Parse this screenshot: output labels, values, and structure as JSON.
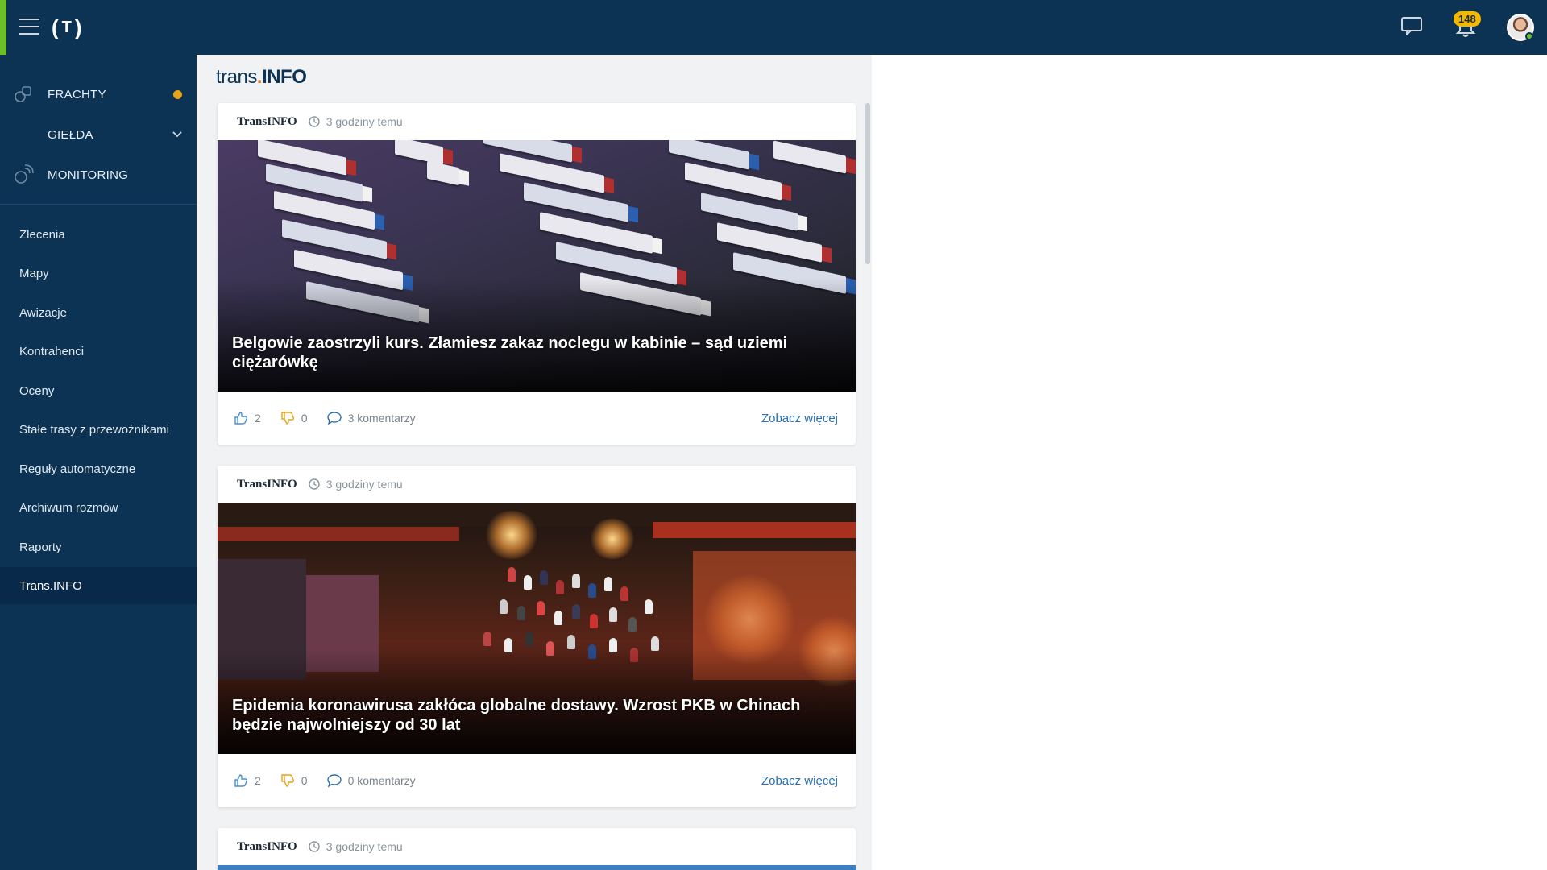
{
  "topbar": {
    "logo_letter": "T",
    "notification_count": "148",
    "icons": [
      "menu-icon",
      "chat-icon",
      "bell-icon",
      "avatar"
    ]
  },
  "sidebar": {
    "sections": [
      {
        "label": "FRACHTY",
        "icon": "boxes-icon",
        "status": "orange-dot"
      },
      {
        "label": "GIEŁDA",
        "icon": "",
        "chevron": "chevron-down-icon"
      },
      {
        "label": "MONITORING",
        "icon": "satellite-icon"
      }
    ],
    "items": [
      {
        "label": "Zlecenia"
      },
      {
        "label": "Mapy"
      },
      {
        "label": "Awizacje"
      },
      {
        "label": "Kontrahenci"
      },
      {
        "label": "Oceny"
      },
      {
        "label": "Stałe trasy z przewoźnikami"
      },
      {
        "label": "Reguły automatyczne"
      },
      {
        "label": "Archiwum rozmów"
      },
      {
        "label": "Raporty"
      },
      {
        "label": "Trans.INFO",
        "active": true
      }
    ]
  },
  "main": {
    "brand": {
      "prefix": "trans",
      "dot": ".",
      "suffix": "INFO"
    },
    "articles": [
      {
        "source": "TransINFO",
        "time": "3 godziny temu",
        "title": "Belgowie zaostrzyli kurs. Złamiesz zakaz noclegu w kabinie – sąd uziemi ciężarówkę",
        "likes": "2",
        "dislikes": "0",
        "comments": "3 komentarzy",
        "more": "Zobacz więcej"
      },
      {
        "source": "TransINFO",
        "time": "3 godziny temu",
        "title": "Epidemia koronawirusa zakłóca globalne dostawy. Wzrost PKB w Chinach będzie najwolniejszy od 30 lat",
        "likes": "2",
        "dislikes": "0",
        "comments": "0 komentarzy",
        "more": "Zobacz więcej"
      },
      {
        "source": "TransINFO",
        "time": "3 godziny temu"
      }
    ]
  },
  "colors": {
    "navy": "#0c3353",
    "accent_green": "#6bbf2b",
    "badge_yellow": "#f5b800",
    "status_orange": "#e8a317",
    "link_blue": "#2a6fb0"
  }
}
